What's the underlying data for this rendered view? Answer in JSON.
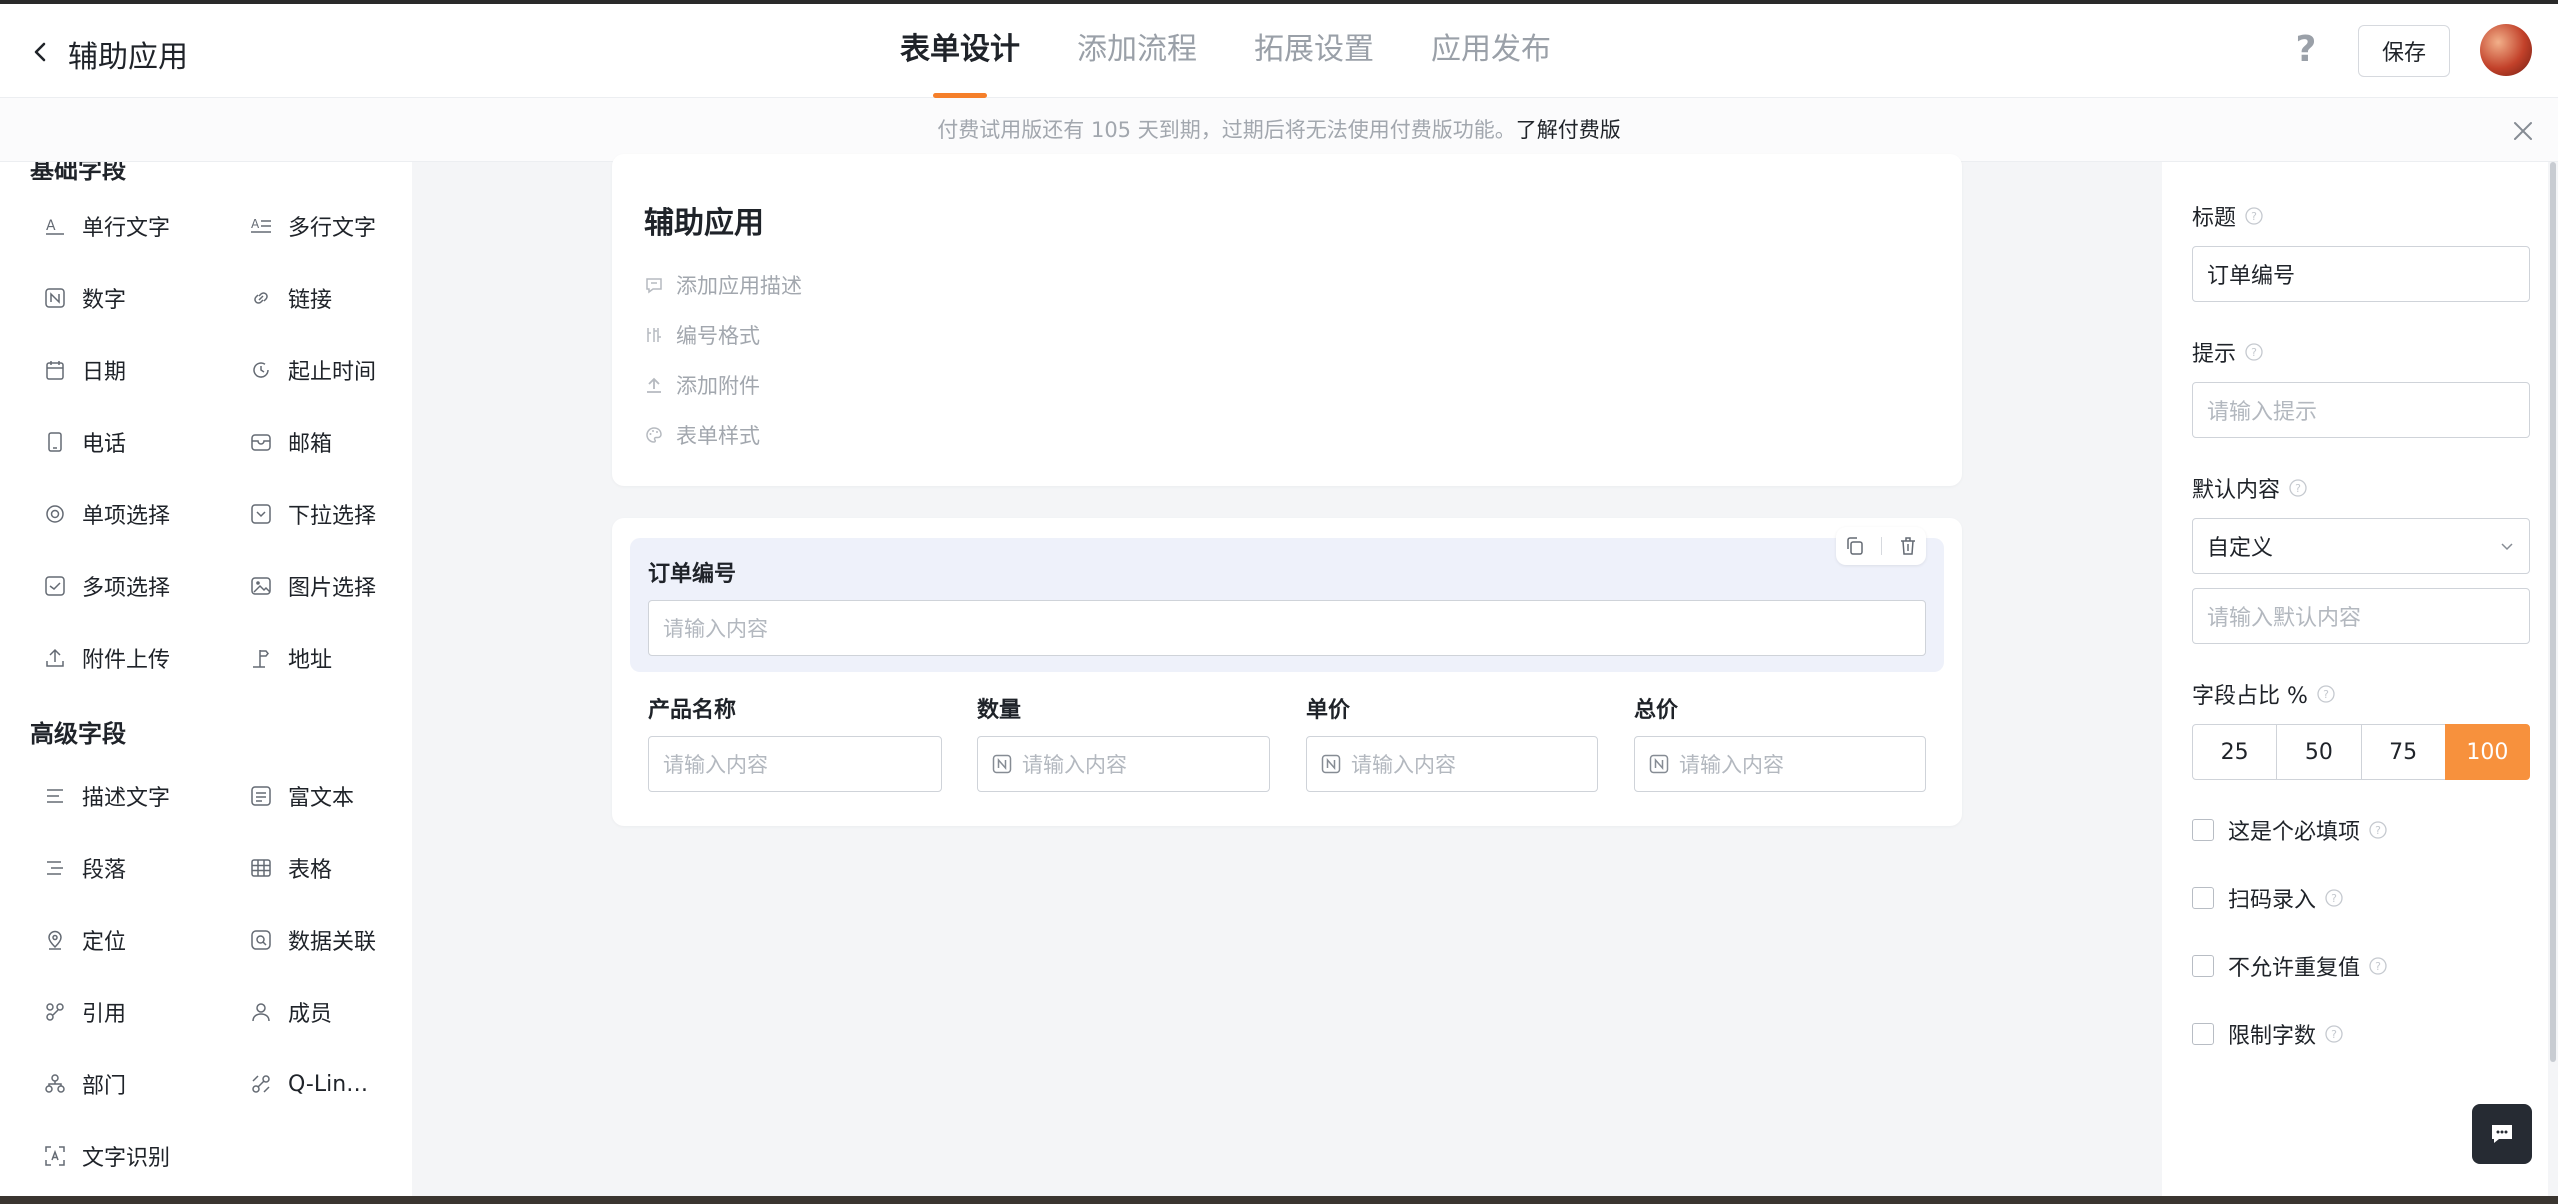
{
  "header": {
    "back_label": "",
    "app_title": "辅助应用",
    "tabs": [
      {
        "label": "表单设计",
        "active": true
      },
      {
        "label": "添加流程",
        "active": false
      },
      {
        "label": "拓展设置",
        "active": false
      },
      {
        "label": "应用发布",
        "active": false
      }
    ],
    "help_label": "?",
    "save_label": "保存"
  },
  "banner": {
    "text": "付费试用版还有 105 天到期，过期后将无法使用付费版功能。",
    "link": "了解付费版"
  },
  "palette": {
    "basic_title": "基础字段",
    "basic_items": [
      {
        "label": "单行文字",
        "icon": "single-line-text-icon"
      },
      {
        "label": "多行文字",
        "icon": "multi-line-text-icon"
      },
      {
        "label": "数字",
        "icon": "number-icon"
      },
      {
        "label": "链接",
        "icon": "link-icon"
      },
      {
        "label": "日期",
        "icon": "calendar-icon"
      },
      {
        "label": "起止时间",
        "icon": "time-range-icon"
      },
      {
        "label": "电话",
        "icon": "phone-icon"
      },
      {
        "label": "邮箱",
        "icon": "mail-icon"
      },
      {
        "label": "单项选择",
        "icon": "radio-icon"
      },
      {
        "label": "下拉选择",
        "icon": "dropdown-icon"
      },
      {
        "label": "多项选择",
        "icon": "checkbox-icon"
      },
      {
        "label": "图片选择",
        "icon": "image-icon"
      },
      {
        "label": "附件上传",
        "icon": "upload-icon"
      },
      {
        "label": "地址",
        "icon": "address-icon"
      }
    ],
    "advanced_title": "高级字段",
    "advanced_items": [
      {
        "label": "描述文字",
        "icon": "description-icon"
      },
      {
        "label": "富文本",
        "icon": "rich-text-icon"
      },
      {
        "label": "段落",
        "icon": "paragraph-icon"
      },
      {
        "label": "表格",
        "icon": "table-icon"
      },
      {
        "label": "定位",
        "icon": "location-icon"
      },
      {
        "label": "数据关联",
        "icon": "data-link-icon"
      },
      {
        "label": "引用",
        "icon": "reference-icon"
      },
      {
        "label": "成员",
        "icon": "member-icon"
      },
      {
        "label": "部门",
        "icon": "department-icon"
      },
      {
        "label": "Q-Lin…",
        "icon": "q-link-icon"
      },
      {
        "label": "文字识别",
        "icon": "ocr-icon"
      }
    ]
  },
  "form": {
    "name": "辅助应用",
    "meta": [
      {
        "label": "添加应用描述",
        "icon": "comment-icon"
      },
      {
        "label": "编号格式",
        "icon": "numbering-icon"
      },
      {
        "label": "添加附件",
        "icon": "attachment-icon"
      },
      {
        "label": "表单样式",
        "icon": "palette-icon"
      }
    ],
    "selected_field": {
      "label": "订单编号",
      "placeholder": "请输入内容"
    },
    "row_fields": [
      {
        "label": "产品名称",
        "placeholder": "请输入内容",
        "numeric": false
      },
      {
        "label": "数量",
        "placeholder": "请输入内容",
        "numeric": true
      },
      {
        "label": "单价",
        "placeholder": "请输入内容",
        "numeric": true
      },
      {
        "label": "总价",
        "placeholder": "请输入内容",
        "numeric": true
      }
    ]
  },
  "props": {
    "title_label": "标题",
    "title_value": "订单编号",
    "hint_label": "提示",
    "hint_placeholder": "请输入提示",
    "default_label": "默认内容",
    "default_select": "自定义",
    "default_placeholder": "请输入默认内容",
    "ratio_label": "字段占比 %",
    "ratio_options": [
      "25",
      "50",
      "75",
      "100"
    ],
    "ratio_selected": "100",
    "checks": [
      {
        "label": "这是个必填项"
      },
      {
        "label": "扫码录入"
      },
      {
        "label": "不允许重复值"
      },
      {
        "label": "限制字数"
      }
    ]
  },
  "colors": {
    "accent": "#f7913d",
    "tab_indicator": "#f57f2a",
    "selected_field_bg": "#eef1fa"
  }
}
